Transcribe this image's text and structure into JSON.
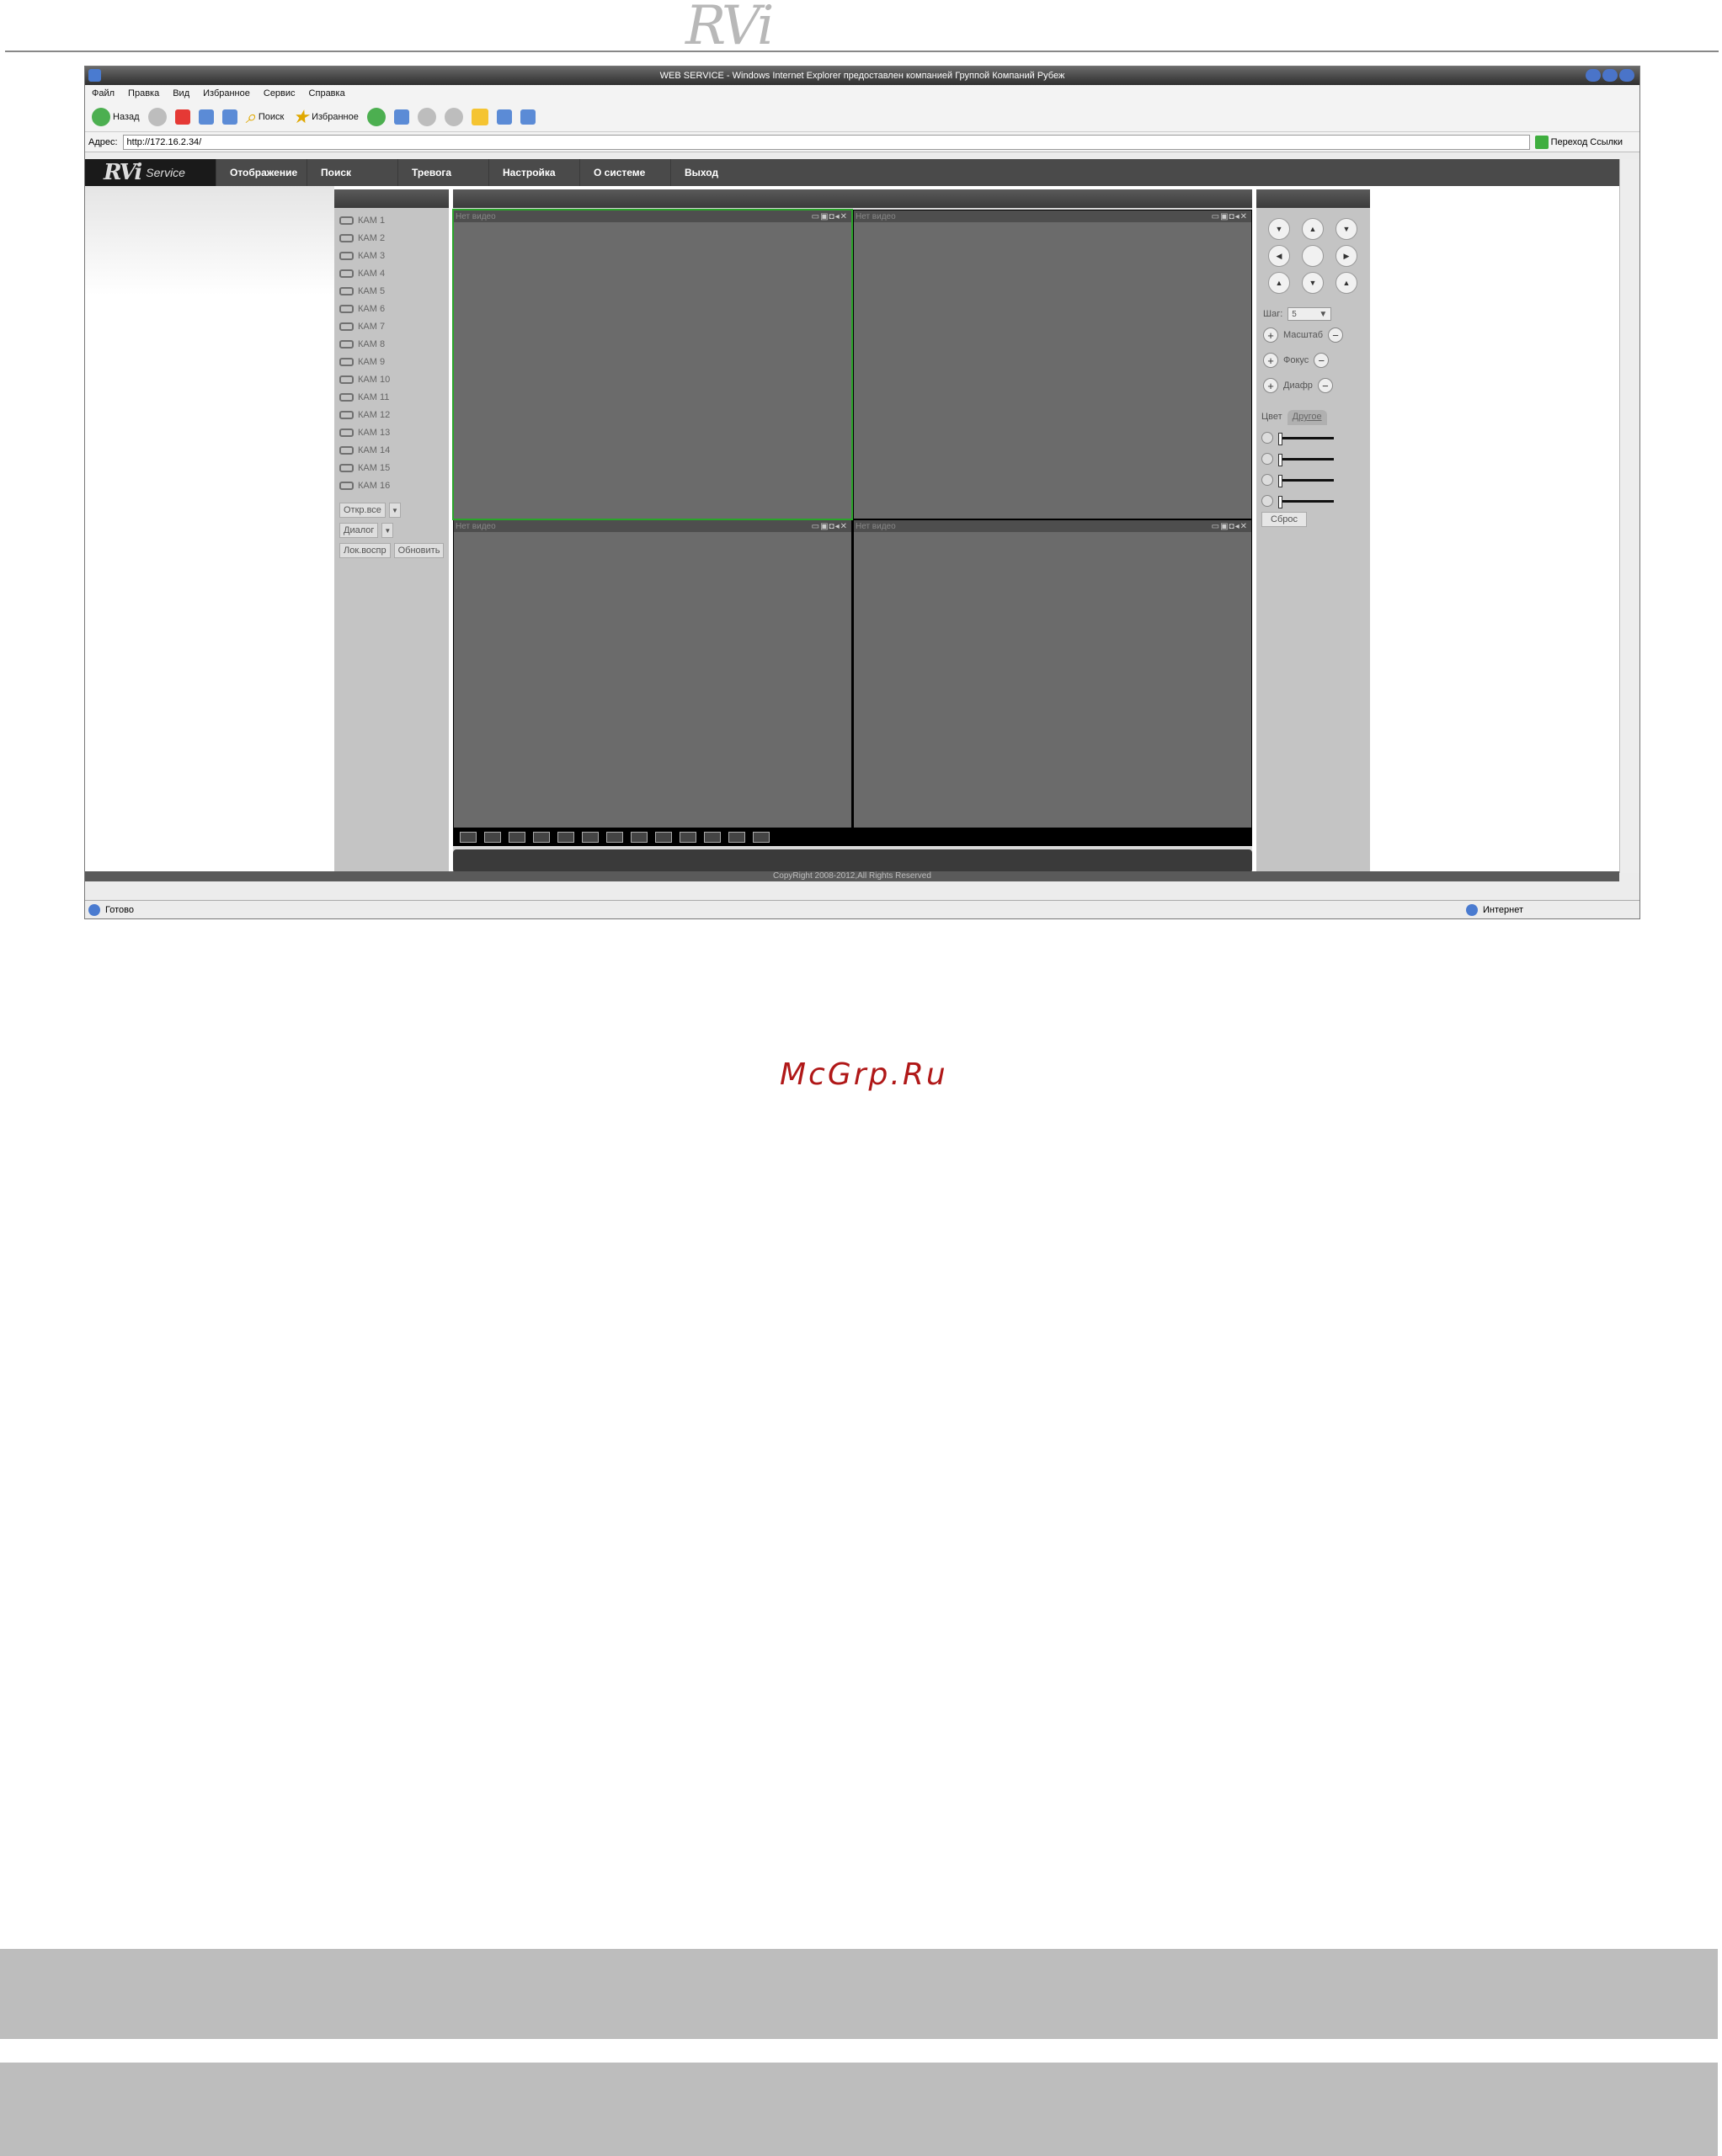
{
  "logo": "RVi",
  "window": {
    "title": "WEB SERVICE - Windows Internet Explorer предоставлен компанией Группой Компаний Рубеж"
  },
  "menu": [
    "Файл",
    "Правка",
    "Вид",
    "Избранное",
    "Сервис",
    "Справка"
  ],
  "toolbar": {
    "back": "Назад",
    "search": "Поиск",
    "favorites": "Избранное"
  },
  "address": {
    "label": "Адрес:",
    "url": "http://172.16.2.34/",
    "go": "Переход",
    "links": "Ссылки"
  },
  "app": {
    "brand": "RVi",
    "brand_sub": "Service",
    "nav": [
      "Отображение",
      "Поиск",
      "Тревога",
      "Настройка",
      "О системе",
      "Выход"
    ]
  },
  "cameras": [
    "КАМ 1",
    "КАМ 2",
    "КАМ 3",
    "КАМ 4",
    "КАМ 5",
    "КАМ 6",
    "КАМ 7",
    "КАМ 8",
    "КАМ 9",
    "КАМ 10",
    "КАМ 11",
    "КАМ 12",
    "КАМ 13",
    "КАМ 14",
    "КАМ 15",
    "КАМ 16"
  ],
  "controls": {
    "open_all": "Откр.все",
    "dialog": "Диалог",
    "local_play": "Лок.воспр",
    "refresh": "Обновить"
  },
  "video": {
    "no_video": "Нет видео"
  },
  "ptz": {
    "step_label": "Шаг:",
    "step_value": "5",
    "zoom": "Масштаб",
    "focus": "Фокус",
    "iris": "Диафр",
    "tab_color": "Цвет",
    "tab_other": "Другое",
    "reset": "Сброс"
  },
  "footer": "CopyRight 2008-2012,All Rights Reserved",
  "status": {
    "ready": "Готово",
    "zone": "Интернет"
  },
  "watermark": "McGrp.Ru"
}
